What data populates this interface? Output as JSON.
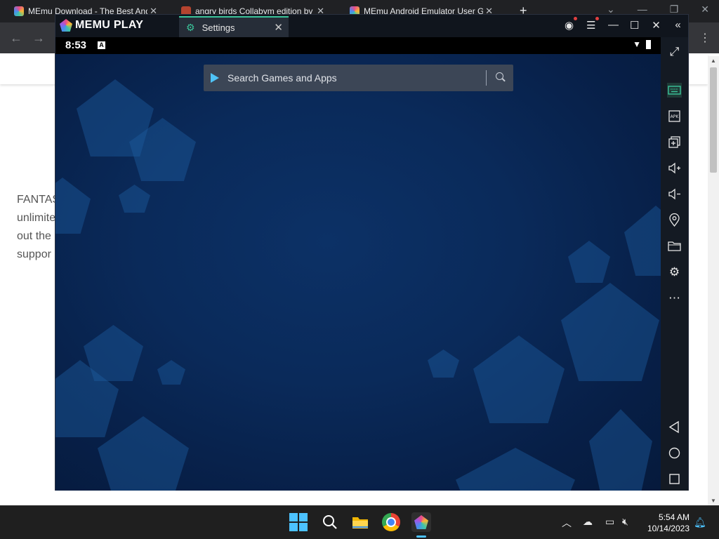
{
  "browser": {
    "tabs": [
      {
        "title": "MEmu Download - The Best And"
      },
      {
        "title": "angry birds Collabym edition by"
      },
      {
        "title": "MEmu Android Emulator User G"
      }
    ],
    "new_tab_glyph": "+",
    "page_text_lines": [
      "FANTAS",
      "unlimite",
      "out the",
      "suppor"
    ]
  },
  "memu": {
    "logo_text": "MEMU PLAY",
    "tab_title": "Settings",
    "status": {
      "time": "8:53",
      "indicator": "A"
    },
    "search_placeholder": "Search Games and Apps",
    "sidebar_icons": [
      "fullscreen-icon",
      "keyboard-icon",
      "apk-icon",
      "multi-instance-icon",
      "volume-up-icon",
      "volume-down-icon",
      "location-icon",
      "folder-icon",
      "settings-icon",
      "more-icon",
      "back-icon",
      "home-icon",
      "recents-icon"
    ],
    "accent_color": "#3bc49a"
  },
  "taskbar": {
    "clock_time": "5:54 AM",
    "clock_date": "10/14/2023"
  }
}
